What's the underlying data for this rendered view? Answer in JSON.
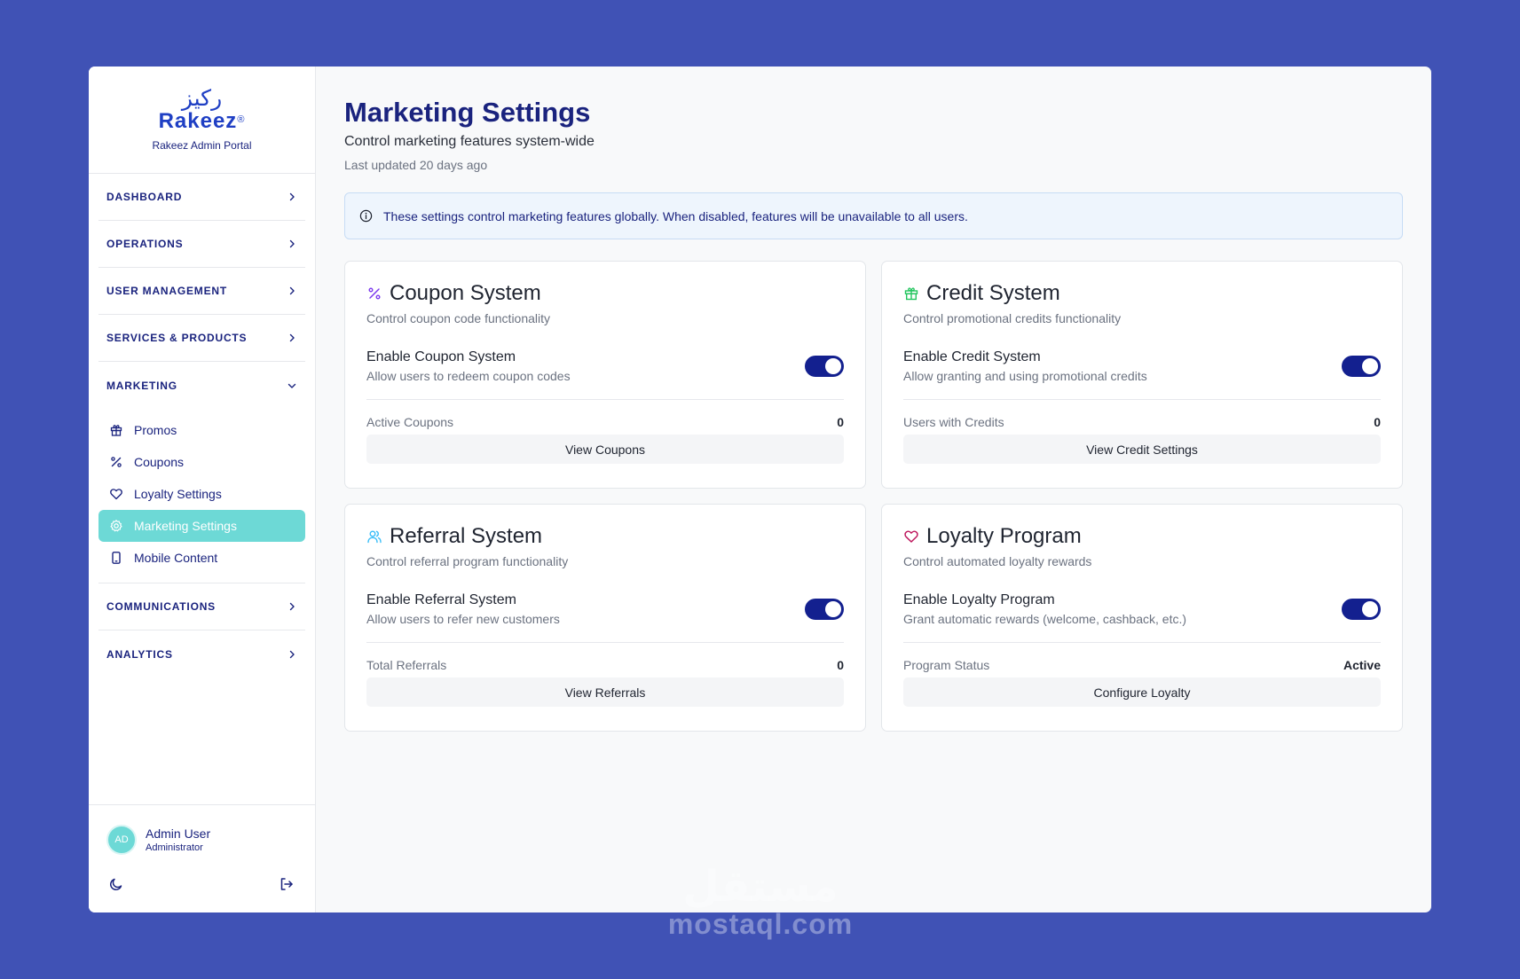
{
  "brand": {
    "arabic": "ركيز",
    "name": "Rakeez",
    "reg": "®",
    "subtitle": "Rakeez Admin Portal"
  },
  "sidebar": {
    "sections": [
      {
        "label": "DASHBOARD"
      },
      {
        "label": "OPERATIONS"
      },
      {
        "label": "USER MANAGEMENT"
      },
      {
        "label": "SERVICES & PRODUCTS"
      },
      {
        "label": "MARKETING"
      },
      {
        "label": "COMMUNICATIONS"
      },
      {
        "label": "ANALYTICS"
      }
    ],
    "marketing_items": [
      {
        "label": "Promos",
        "icon": "gift-icon"
      },
      {
        "label": "Coupons",
        "icon": "percent-icon"
      },
      {
        "label": "Loyalty Settings",
        "icon": "heart-icon"
      },
      {
        "label": "Marketing Settings",
        "icon": "settings-icon",
        "active": true
      },
      {
        "label": "Mobile Content",
        "icon": "smartphone-icon"
      }
    ],
    "user": {
      "initials": "AD",
      "name": "Admin User",
      "role": "Administrator"
    }
  },
  "main": {
    "title": "Marketing Settings",
    "subtitle": "Control marketing features system-wide",
    "updated": "Last updated 20 days ago",
    "alert": "These settings control marketing features globally. When disabled, features will be unavailable to all users."
  },
  "cards": [
    {
      "title": "Coupon System",
      "description": "Control coupon code functionality",
      "toggle_label": "Enable Coupon System",
      "toggle_desc": "Allow users to redeem coupon codes",
      "enabled": true,
      "stat_label": "Active Coupons",
      "stat_value": "0",
      "button": "View Coupons",
      "icon": "percent-icon",
      "icon_color": "#7c3aed"
    },
    {
      "title": "Credit System",
      "description": "Control promotional credits functionality",
      "toggle_label": "Enable Credit System",
      "toggle_desc": "Allow granting and using promotional credits",
      "enabled": true,
      "stat_label": "Users with Credits",
      "stat_value": "0",
      "button": "View Credit Settings",
      "icon": "gift-icon",
      "icon_color": "#22c55e"
    },
    {
      "title": "Referral System",
      "description": "Control referral program functionality",
      "toggle_label": "Enable Referral System",
      "toggle_desc": "Allow users to refer new customers",
      "enabled": true,
      "stat_label": "Total Referrals",
      "stat_value": "0",
      "button": "View Referrals",
      "icon": "users-icon",
      "icon_color": "#38bdf8"
    },
    {
      "title": "Loyalty Program",
      "description": "Control automated loyalty rewards",
      "toggle_label": "Enable Loyalty Program",
      "toggle_desc": "Grant automatic rewards (welcome, cashback, etc.)",
      "enabled": true,
      "stat_label": "Program Status",
      "stat_value": "Active",
      "button": "Configure Loyalty",
      "icon": "heart-icon",
      "icon_color": "#be185d"
    }
  ],
  "watermark": {
    "arabic": "مستقل",
    "text": "mostaql.com"
  },
  "colors": {
    "background": "#4052b5",
    "primary": "#1a237e",
    "accent": "#6dd9d6",
    "toggle_on": "#13208f"
  }
}
